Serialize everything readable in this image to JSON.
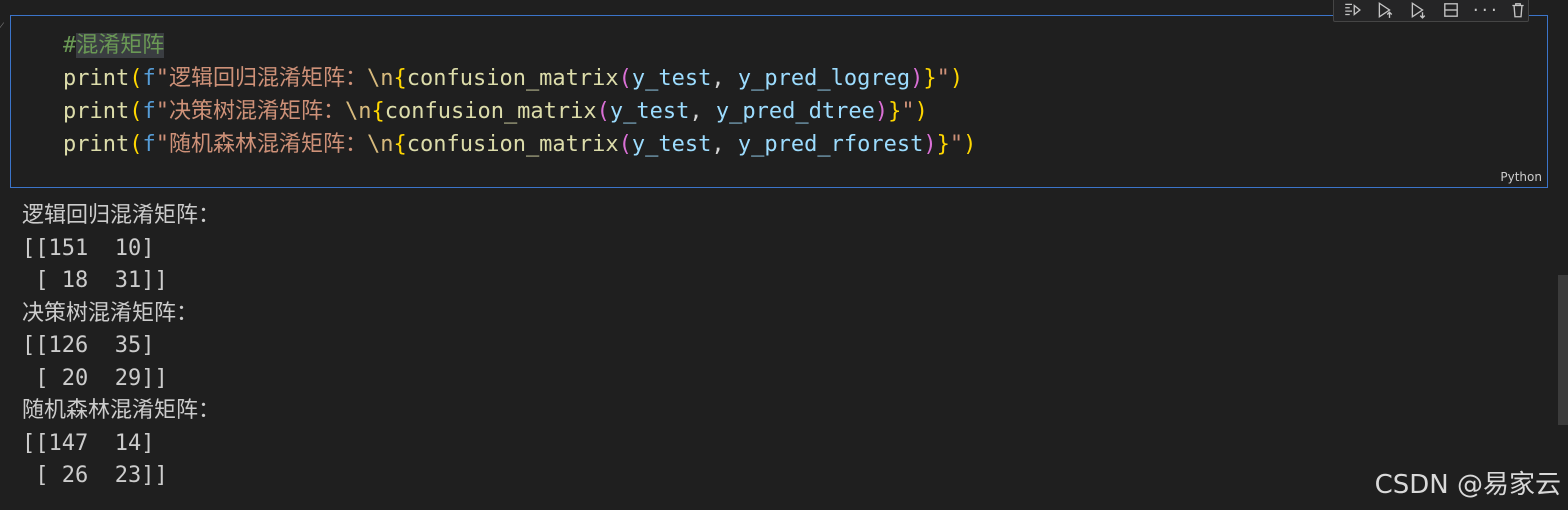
{
  "cell": {
    "language": "Python",
    "code_lines": [
      {
        "parts": [
          {
            "cls": "comment",
            "text": "#"
          },
          {
            "cls": "comment hl",
            "text": "混淆矩阵"
          }
        ]
      },
      {
        "parts": [
          {
            "cls": "fn",
            "text": "print"
          },
          {
            "cls": "paren1",
            "text": "("
          },
          {
            "cls": "kw",
            "text": "f"
          },
          {
            "cls": "str",
            "text": "\"逻辑回归混淆矩阵："
          },
          {
            "cls": "esc",
            "text": "\\n"
          },
          {
            "cls": "paren1",
            "text": "{"
          },
          {
            "cls": "fn",
            "text": "confusion_matrix"
          },
          {
            "cls": "paren2",
            "text": "("
          },
          {
            "cls": "var",
            "text": "y_test"
          },
          {
            "cls": "punct",
            "text": ", "
          },
          {
            "cls": "var",
            "text": "y_pred_logreg"
          },
          {
            "cls": "paren2",
            "text": ")"
          },
          {
            "cls": "paren1",
            "text": "}"
          },
          {
            "cls": "str",
            "text": "\""
          },
          {
            "cls": "paren1",
            "text": ")"
          }
        ]
      },
      {
        "parts": [
          {
            "cls": "fn",
            "text": "print"
          },
          {
            "cls": "paren1",
            "text": "("
          },
          {
            "cls": "kw",
            "text": "f"
          },
          {
            "cls": "str",
            "text": "\"决策树混淆矩阵："
          },
          {
            "cls": "esc",
            "text": "\\n"
          },
          {
            "cls": "paren1",
            "text": "{"
          },
          {
            "cls": "fn",
            "text": "confusion_matrix"
          },
          {
            "cls": "paren2",
            "text": "("
          },
          {
            "cls": "var",
            "text": "y_test"
          },
          {
            "cls": "punct",
            "text": ", "
          },
          {
            "cls": "var",
            "text": "y_pred_dtree"
          },
          {
            "cls": "paren2",
            "text": ")"
          },
          {
            "cls": "paren1",
            "text": "}"
          },
          {
            "cls": "str",
            "text": "\""
          },
          {
            "cls": "paren1",
            "text": ")"
          }
        ]
      },
      {
        "parts": [
          {
            "cls": "fn",
            "text": "print"
          },
          {
            "cls": "paren1",
            "text": "("
          },
          {
            "cls": "kw",
            "text": "f"
          },
          {
            "cls": "str",
            "text": "\"随机森林混淆矩阵："
          },
          {
            "cls": "esc",
            "text": "\\n"
          },
          {
            "cls": "paren1",
            "text": "{"
          },
          {
            "cls": "fn",
            "text": "confusion_matrix"
          },
          {
            "cls": "paren2",
            "text": "("
          },
          {
            "cls": "var",
            "text": "y_test"
          },
          {
            "cls": "punct",
            "text": ", "
          },
          {
            "cls": "var",
            "text": "y_pred_rforest"
          },
          {
            "cls": "paren2",
            "text": ")"
          },
          {
            "cls": "paren1",
            "text": "}"
          },
          {
            "cls": "str",
            "text": "\""
          },
          {
            "cls": "paren1",
            "text": ")"
          }
        ]
      }
    ],
    "toolbar_icons": [
      "run-by-line-icon",
      "execute-above-icon",
      "execute-below-icon",
      "split-cell-icon",
      "more-icon",
      "delete-icon"
    ]
  },
  "output_lines": [
    "逻辑回归混淆矩阵：",
    "[[151  10]",
    " [ 18  31]]",
    "决策树混淆矩阵：",
    "[[126  35]",
    " [ 20  29]]",
    "随机森林混淆矩阵：",
    "[[147  14]",
    " [ 26  23]]"
  ],
  "watermark": "CSDN @易家云",
  "colors": {
    "background": "#1f1f1f",
    "cell_border": "#3b74c9",
    "comment": "#6a9955",
    "function": "#dcdcaa",
    "string": "#ce9178",
    "variable": "#9cdcfe"
  }
}
